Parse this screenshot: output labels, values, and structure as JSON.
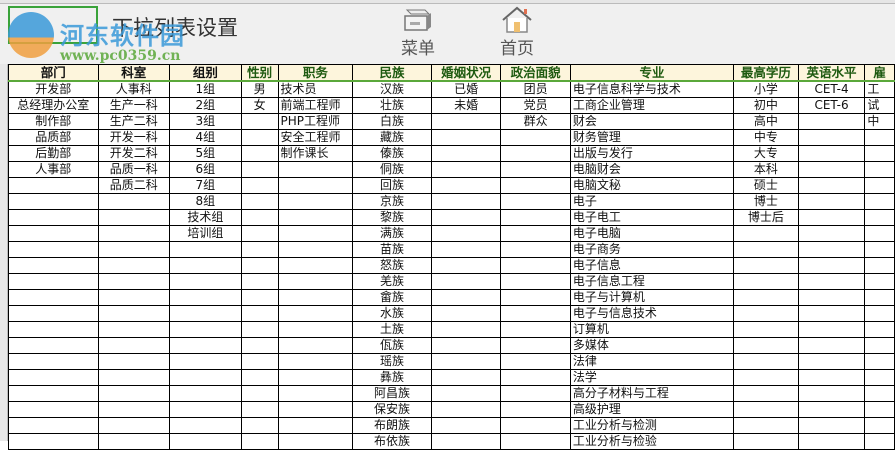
{
  "toolbar": {
    "title": "下拉列表设置",
    "menu_label": "菜单",
    "home_label": "首页"
  },
  "watermark": {
    "name": "河东软件园",
    "url": "www.pc0359.cn"
  },
  "columns": [
    {
      "header": "部门",
      "align": "center",
      "values": [
        "开发部",
        "总经理办公室",
        "制作部",
        "品质部",
        "后勤部",
        "人事部"
      ]
    },
    {
      "header": "科室",
      "align": "center",
      "values": [
        "人事科",
        "生产一科",
        "生产二科",
        "开发一科",
        "开发二科",
        "品质一科",
        "品质二科"
      ]
    },
    {
      "header": "组别",
      "align": "center",
      "values": [
        "1组",
        "2组",
        "3组",
        "4组",
        "5组",
        "6组",
        "7组",
        "8组",
        "技术组",
        "培训组"
      ]
    },
    {
      "header": "性别",
      "align": "center",
      "values": [
        "男",
        "女"
      ]
    },
    {
      "header": "职务",
      "align": "left",
      "values": [
        "技术员",
        "前端工程师",
        "PHP工程师",
        "安全工程师",
        "制作课长"
      ]
    },
    {
      "header": "民族",
      "align": "center",
      "values": [
        "汉族",
        "壮族",
        "白族",
        "藏族",
        "傣族",
        "侗族",
        "回族",
        "京族",
        "黎族",
        "满族",
        "苗族",
        "怒族",
        "羌族",
        "畲族",
        "水族",
        "土族",
        "佤族",
        "瑶族",
        "彝族",
        "阿昌族",
        "保安族",
        "布朗族",
        "布依族"
      ]
    },
    {
      "header": "婚姻状况",
      "align": "center",
      "values": [
        "已婚",
        "未婚"
      ]
    },
    {
      "header": "政治面貌",
      "align": "center",
      "values": [
        "团员",
        "党员",
        "群众"
      ]
    },
    {
      "header": "专业",
      "align": "left",
      "values": [
        "电子信息科学与技术",
        "工商企业管理",
        "财会",
        "财务管理",
        "出版与发行",
        "电脑财会",
        "电脑文秘",
        "电子",
        "电子电工",
        "电子电脑",
        "电子商务",
        "电子信息",
        "电子信息工程",
        "电子与计算机",
        "电子与信息技术",
        "订算机",
        "多媒体",
        "法律",
        "法学",
        "高分子材料与工程",
        "高级护理",
        "工业分析与检测",
        "工业分析与检验"
      ]
    },
    {
      "header": "最高学历",
      "align": "center",
      "values": [
        "小学",
        "初中",
        "高中",
        "中专",
        "大专",
        "本科",
        "硕士",
        "博士",
        "博士后"
      ]
    },
    {
      "header": "英语水平",
      "align": "center",
      "values": [
        "CET-4",
        "CET-6"
      ]
    },
    {
      "header": "雇",
      "align": "left",
      "values": [
        "工",
        "试",
        "中"
      ]
    }
  ],
  "colors": {
    "header_bg": "#fdf5dc",
    "header_text": "#1e5a10",
    "accent": "#3aa33a"
  }
}
